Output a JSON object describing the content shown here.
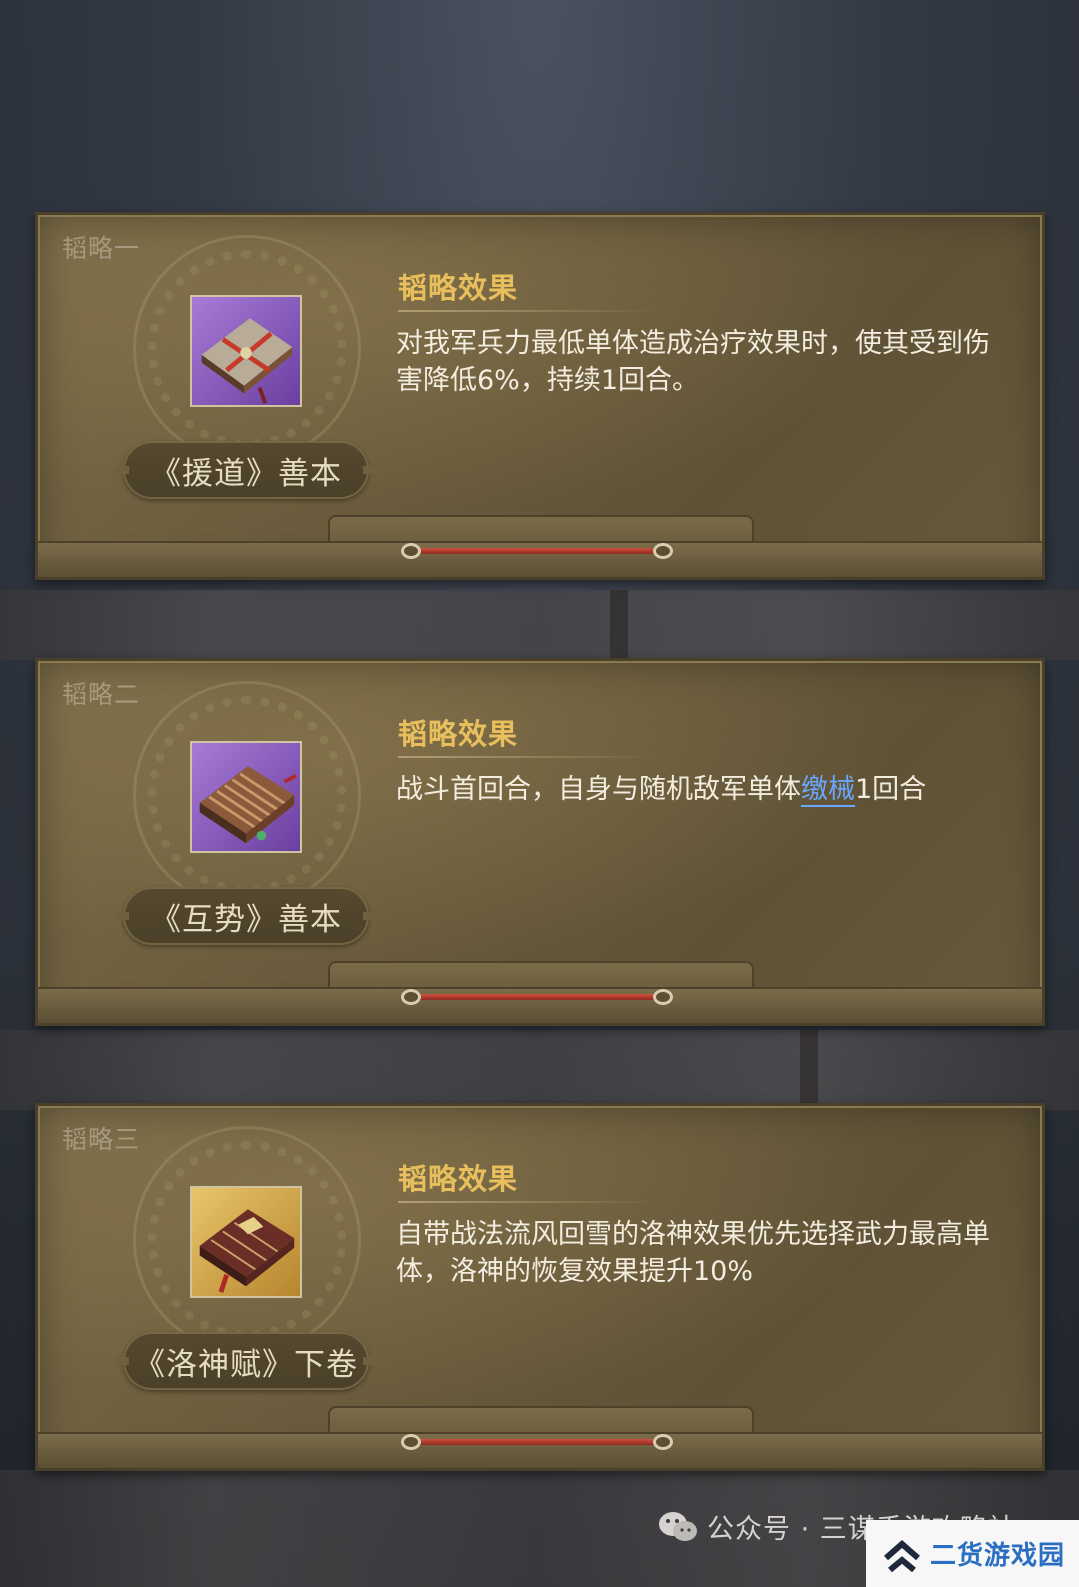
{
  "cards": [
    {
      "index_label": "韬略一",
      "item_name": "《援道》善本",
      "effect_title": "韬略效果",
      "effect_text": "对我军兵力最低单体造成治疗效果时，使其受到伤害降低6%，持续1回合。",
      "icon": "purple-book-icon"
    },
    {
      "index_label": "韬略二",
      "item_name": "《互势》善本",
      "effect_title": "韬略效果",
      "effect_pre": "战斗首回合，自身与随机敌军单体",
      "effect_keyword": "缴械",
      "effect_post": "1回合",
      "icon": "bamboo-scroll-icon"
    },
    {
      "index_label": "韬略三",
      "item_name": "《洛神赋》下卷",
      "effect_title": "韬略效果",
      "effect_text": "自带战法流风回雪的洛神效果优先选择武力最高单体，洛神的恢复效果提升10%",
      "icon": "gold-book-icon"
    }
  ],
  "watermark": {
    "text": "公众号 · 三谋手游攻略社"
  },
  "site_badge": {
    "name": "二货游戏园"
  },
  "colors": {
    "effect_title": "#e8bf5c",
    "keyword": "#6aa6ff",
    "card_bg": "#6b5c3d"
  }
}
